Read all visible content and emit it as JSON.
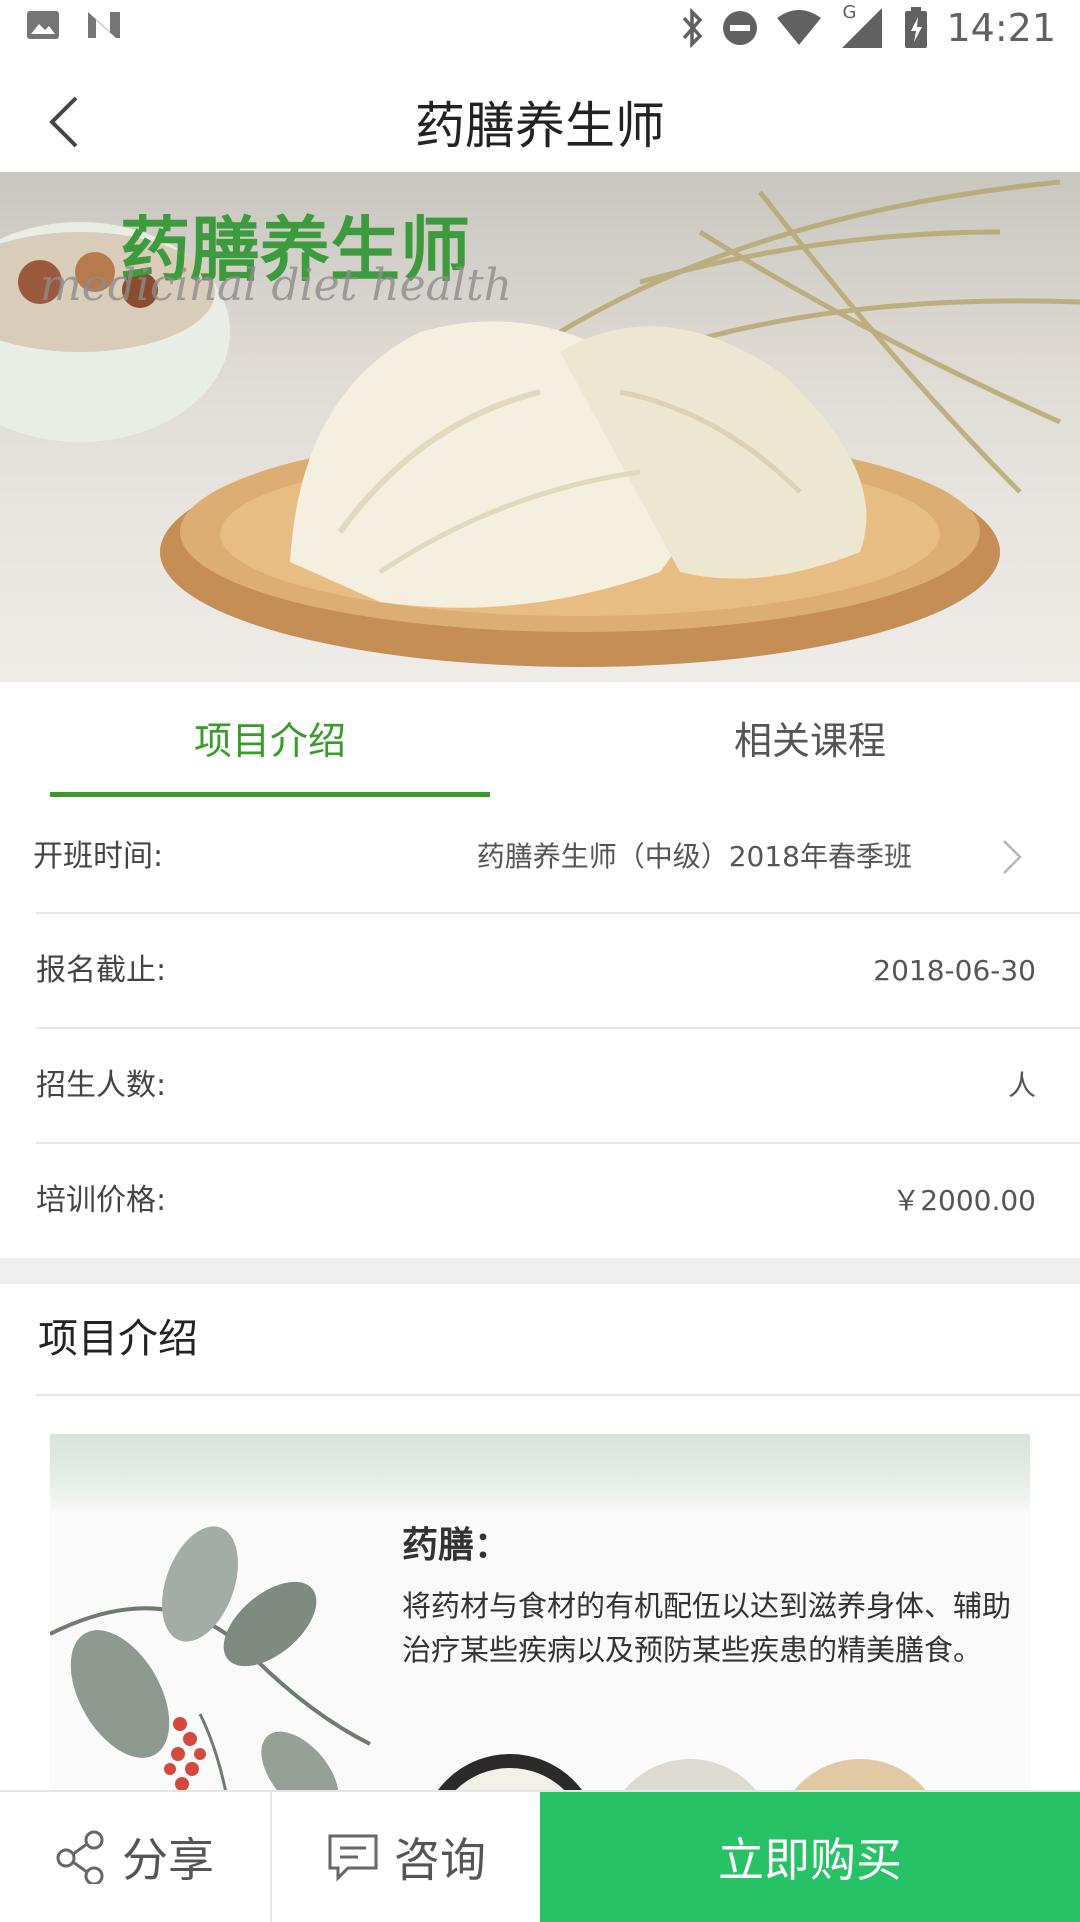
{
  "status_bar": {
    "time": "14:21",
    "network_label": "G"
  },
  "header": {
    "title": "药膳养生师"
  },
  "hero": {
    "logo_text": "药膳养生师",
    "logo_subtext": "medicinal diet health"
  },
  "tabs": [
    {
      "label": "项目介绍",
      "active": true
    },
    {
      "label": "相关课程",
      "active": false
    }
  ],
  "info": {
    "start_label": "开班时间:",
    "start_value": "药膳养生师（中级）2018年春季班",
    "deadline_label": "报名截止:",
    "deadline_value": "2018-06-30",
    "enroll_label": "招生人数:",
    "enroll_value": "人",
    "price_label": "培训价格:",
    "price_value": "￥2000.00"
  },
  "section": {
    "title": "项目介绍"
  },
  "intro": {
    "heading": "药膳：",
    "description": "将药材与食材的有机配伍以达到滋养身体、辅助治疗某些疾病以及预防某些疾患的精美膳食。"
  },
  "bottom_bar": {
    "share_label": "分享",
    "consult_label": "咨询",
    "buy_label": "立即购买"
  },
  "colors": {
    "accent_green": "#3a9b2a",
    "buy_green": "#27c265"
  }
}
